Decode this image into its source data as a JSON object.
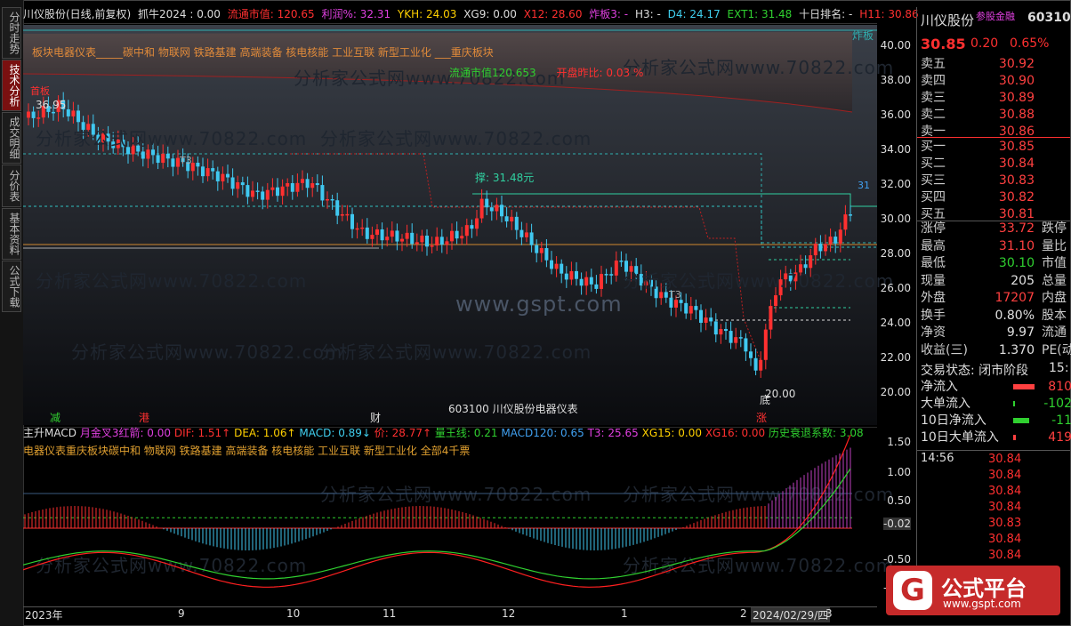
{
  "left_tabs": [
    "分时走势",
    "技术分析",
    "成交明细",
    "分价表",
    "基本资料",
    "公式下载"
  ],
  "info_bar": {
    "name": "川仪股份(日线,前复权)",
    "indicator": "抓牛2024 : 0.00",
    "liutong": "流通市值: 120.65",
    "lirun": "利润%: 32.31",
    "ykh": "YKH: 24.03",
    "xg9": "XG9: 0.00",
    "x12": "X12: 28.60",
    "zhaban": "炸板3: -",
    "h3": "H3: -",
    "d4": "D4: 24.17",
    "ext1": "EXT1: 31.48",
    "shiri": "十日排名: -",
    "h11": "H11: 30.86"
  },
  "sector_text": "板块电器仪表_____碳中和 物联网 铁路基建 高端装备 核电核能 工业互联 新型工业化 ___重庆板块",
  "float_value": {
    "label": "流通市值",
    "value": "120.653"
  },
  "open_change": {
    "label": "开盘昨比:",
    "value": "0.03",
    "unit": "%"
  },
  "zhaban_tag": "炸板",
  "chart_labels": {
    "high_price": "36.95",
    "low_price": "20.00",
    "low_tag": "底",
    "support": "撑: 31.48元",
    "t3_a": "T3",
    "t3_b": "T3",
    "stock_caption": "603100 川仪股份电器仪表",
    "right_marker": "31",
    "corner_tag": "首板"
  },
  "markers": [
    "减",
    "港",
    "财",
    "涨"
  ],
  "watermark": "分析家公式网www.70822.com",
  "gspt": "www.gspt.com",
  "price_axis": [
    "40.00",
    "38.00",
    "36.00",
    "34.00",
    "32.00",
    "30.00",
    "28.00",
    "26.00",
    "24.00",
    "22.00",
    "20.00"
  ],
  "macd_axis": [
    "1.50",
    "1.00",
    "0.50",
    "-0.02",
    "-0.50",
    "-1.00"
  ],
  "macd_bar": {
    "name": "主升MACD",
    "yuejin": "月金叉3红箭: 0.00",
    "dif": "DIF: 1.51↑",
    "dea": "DEA: 1.06↑",
    "macd": "MACD: 0.89↓",
    "price": "价: 28.77↑",
    "liang": "量王线: 0.21",
    "macd120": "MACD120: 0.65",
    "t3": "T3: 25.65",
    "xg15": "XG15: 0.00",
    "xg16": "XG16: 0.00",
    "lishi": "历史衰退系数: 3.08"
  },
  "macd_sectors": "电器仪表重庆板块碳中和 物联网 铁路基建 高端装备 核电核能 工业互联 新型工业化 全部4千票",
  "x_axis": [
    "2023年",
    "9",
    "10",
    "11",
    "12",
    "1",
    "2",
    "2024/02/29/四",
    "3"
  ],
  "panel": {
    "stock_name": "川仪股份",
    "badge": "参股金融",
    "code": "603100",
    "price": "30.85",
    "change": "0.20",
    "change_pct": "0.65%",
    "asks": [
      {
        "label": "卖五",
        "price": "30.92"
      },
      {
        "label": "卖四",
        "price": "30.90"
      },
      {
        "label": "卖三",
        "price": "30.89"
      },
      {
        "label": "卖二",
        "price": "30.88"
      },
      {
        "label": "卖一",
        "price": "30.86"
      }
    ],
    "bids": [
      {
        "label": "买一",
        "price": "30.85"
      },
      {
        "label": "买二",
        "price": "30.84"
      },
      {
        "label": "买三",
        "price": "30.83"
      },
      {
        "label": "买四",
        "price": "30.82"
      },
      {
        "label": "买五",
        "price": "30.81"
      }
    ],
    "stats": [
      {
        "label": "涨停",
        "value": "33.72",
        "label2": "跌停",
        "color": "#ff4040"
      },
      {
        "label": "最高",
        "value": "31.10",
        "label2": "量比",
        "color": "#ff4040"
      },
      {
        "label": "最低",
        "value": "30.10",
        "label2": "市值",
        "color": "#30d030"
      },
      {
        "label": "现量",
        "value": "205",
        "label2": "总量",
        "color": "#e0e0e0"
      },
      {
        "label": "外盘",
        "value": "17207",
        "label2": "内盘",
        "color": "#ff4040"
      },
      {
        "label": "换手",
        "value": "0.80%",
        "label2": "股本",
        "color": "#e0e0e0"
      },
      {
        "label": "净资",
        "value": "9.97",
        "label2": "流通",
        "color": "#e0e0e0"
      },
      {
        "label": "收益(三)",
        "value": "1.370",
        "label2": "PE(动)",
        "color": "#e0e0e0"
      }
    ],
    "trade_status": "交易状态: 闭市阶段",
    "trade_status_extra": "15:",
    "flows": [
      {
        "label": "净流入",
        "value": "810",
        "color": "#ff4040",
        "bar": 0.8
      },
      {
        "label": "大单流入",
        "value": "-102",
        "color": "#30d030",
        "bar": 0.05
      },
      {
        "label": "10日净流入",
        "value": "-11",
        "color": "#30d030",
        "bar": 0.6
      },
      {
        "label": "10日大单流入",
        "value": "419",
        "color": "#ff4040",
        "bar": 0.1
      }
    ],
    "tick_time": "14:56",
    "ticks": [
      "30.84",
      "30.84",
      "30.84",
      "30.84",
      "30.83",
      "30.84",
      "30.84",
      "30.84",
      "30.83"
    ]
  },
  "logo": {
    "title": "公式平台",
    "url": "www.gspt.com"
  },
  "colors": {
    "up": "#ff3030",
    "down": "#40c8f0",
    "orange": "#e08a3a",
    "green": "#30d030"
  }
}
